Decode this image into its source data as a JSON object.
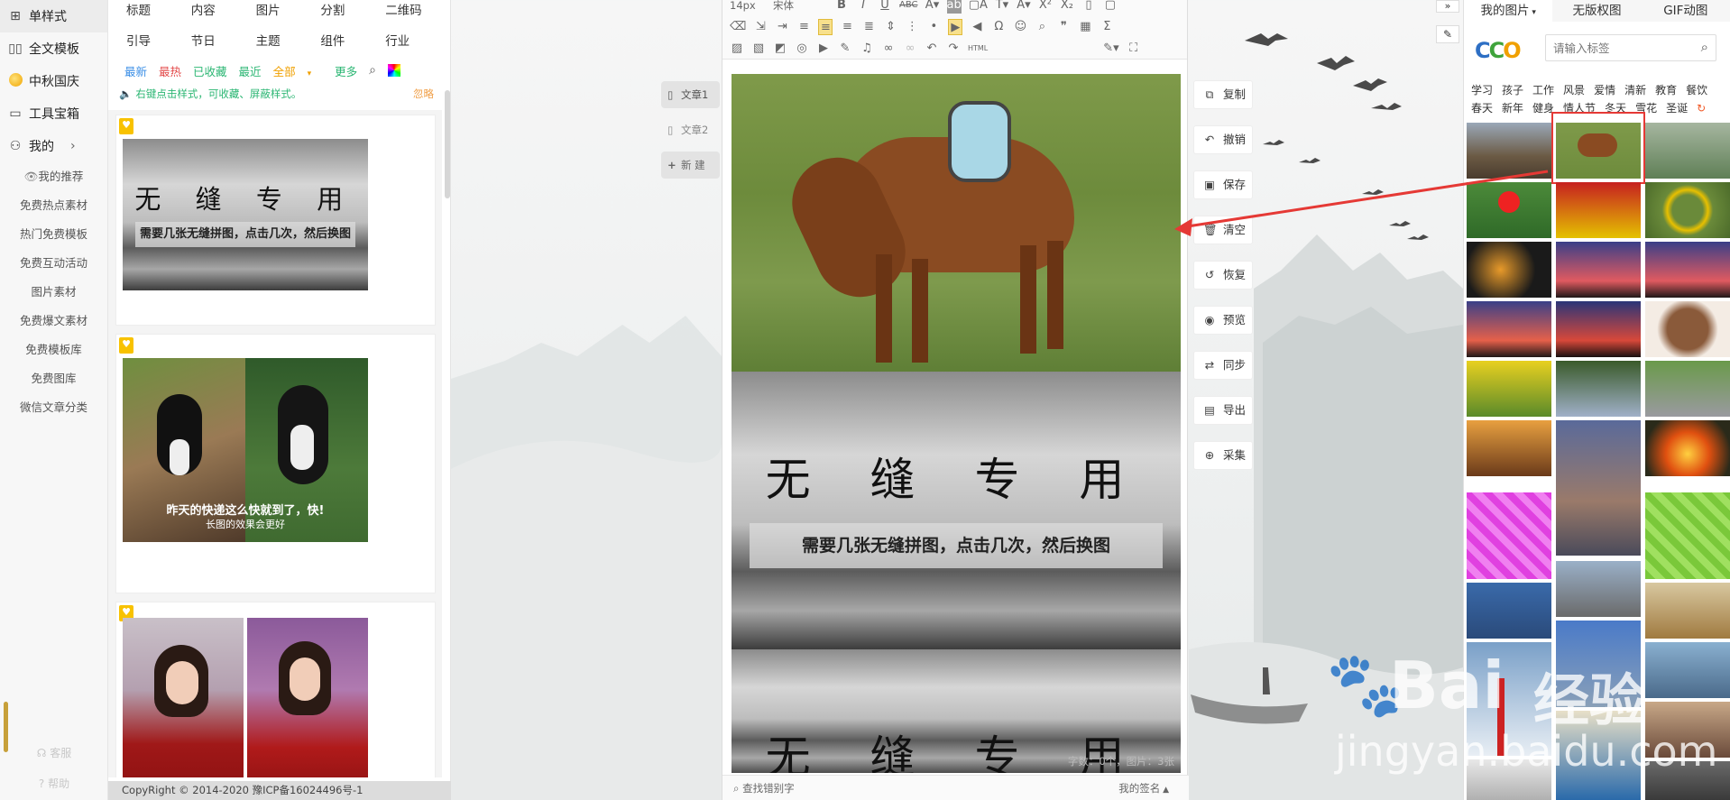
{
  "leftnav": {
    "main": [
      {
        "icon": "grid-icon",
        "label": "单样式"
      },
      {
        "icon": "template-icon",
        "label": "全文模板"
      },
      {
        "icon": "moon-icon",
        "label": "中秋国庆"
      },
      {
        "icon": "toolbox-icon",
        "label": "工具宝箱"
      },
      {
        "icon": "user-icon",
        "label": "我的"
      }
    ],
    "sub": [
      "我的推荐",
      "免费热点素材",
      "热门免费模板",
      "免费互动活动",
      "图片素材",
      "免费爆文素材",
      "免费模板库",
      "免费图库",
      "微信文章分类"
    ],
    "bottom": [
      "客服",
      "帮助"
    ]
  },
  "stylepanel": {
    "categories_row1": [
      "标题",
      "内容",
      "图片",
      "分割",
      "二维码"
    ],
    "categories_row2": [
      "引导",
      "节日",
      "主题",
      "组件",
      "行业"
    ],
    "filters": [
      {
        "label": "最新",
        "color": "#3a8ee6"
      },
      {
        "label": "最热",
        "color": "#e34b4b"
      },
      {
        "label": "已收藏",
        "color": "#2bb673"
      },
      {
        "label": "最近",
        "color": "#2bb673"
      },
      {
        "label": "全部",
        "color": "#f0a000"
      },
      {
        "label": "更多",
        "color": "#2bb673"
      }
    ],
    "tip": "右键点击样式，可收藏、屏蔽样式。",
    "ignore": "忽略",
    "card1": {
      "title": "无 缝 专 用",
      "caption": "需要几张无缝拼图，点击几次，然后换图"
    },
    "card2": {
      "line1": "昨天的快递这么快就到了，快!",
      "line2": "长图的效果会更好"
    },
    "copyright": "CopyRight © 2014-2020 豫ICP备16024496号-1"
  },
  "doctabs": [
    "文章1",
    "文章2",
    "新 建"
  ],
  "editor": {
    "font_size": "14px",
    "font_family": "宋体",
    "block_title": "无 缝 专 用",
    "block_caption": "需要几张无缝拼图，点击几次，然后换图",
    "find_typo": "查找错别字",
    "signature": "我的签名",
    "wordcount": "字数：0个，图片：3张"
  },
  "actions": [
    {
      "icon": "copy-icon",
      "label": "复制"
    },
    {
      "icon": "undo-icon",
      "label": "撤销"
    },
    {
      "icon": "save-icon",
      "label": "保存"
    },
    {
      "icon": "trash-icon",
      "label": "清空"
    },
    {
      "icon": "restore-icon",
      "label": "恢复"
    },
    {
      "icon": "eye-icon",
      "label": "预览"
    },
    {
      "icon": "sync-icon",
      "label": "同步"
    },
    {
      "icon": "export-icon",
      "label": "导出"
    },
    {
      "icon": "collect-icon",
      "label": "采集"
    }
  ],
  "imgpanel": {
    "tabs": [
      "我的图片",
      "无版权图",
      "GIF动图"
    ],
    "logo": "CCO",
    "search_placeholder": "请输入标签",
    "keywords_row1": [
      "学习",
      "孩子",
      "工作",
      "风景",
      "爱情",
      "清新",
      "教育",
      "餐饮"
    ],
    "keywords_row2": [
      "春天",
      "新年",
      "健身",
      "情人节",
      "冬天",
      "雪花",
      "圣诞"
    ]
  },
  "watermark": {
    "brand": "Bai",
    "brand2": "经验",
    "url": "jingyan.baidu.com"
  },
  "colors": {
    "accent": "#f8c200",
    "highlight_box": "#e53935",
    "tip_green": "#2bb673"
  }
}
